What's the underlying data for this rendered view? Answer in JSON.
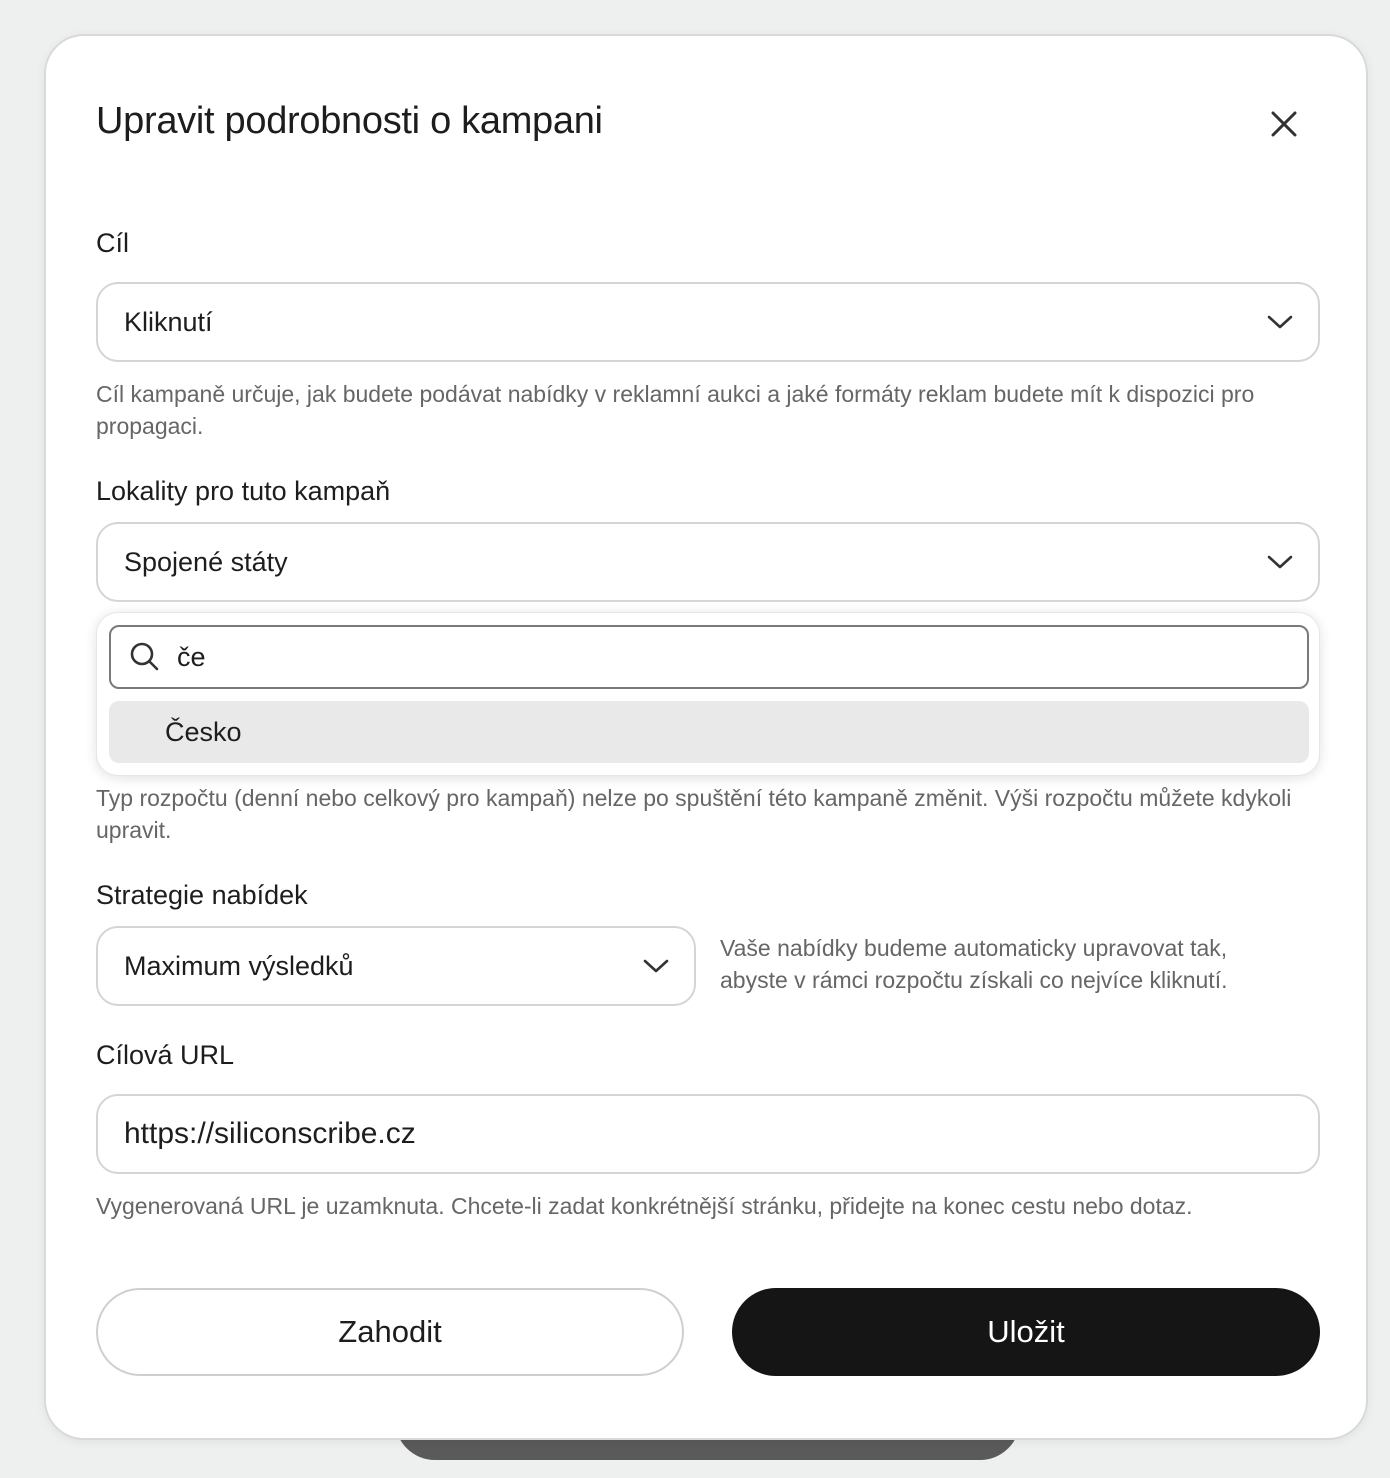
{
  "dialog": {
    "title": "Upravit podrobnosti o kampani",
    "close_icon": "close-icon"
  },
  "goal": {
    "label": "Cíl",
    "value": "Kliknutí",
    "help": "Cíl kampaně určuje, jak budete podávat nabídky v reklamní aukci a jaké formáty reklam budete mít k dispozici pro propagaci."
  },
  "locations": {
    "label": "Lokality pro tuto kampaň",
    "value": "Spojené státy",
    "search_value": "če",
    "options": [
      "Česko"
    ]
  },
  "budget": {
    "help": "Typ rozpočtu (denní nebo celkový pro kampaň) nelze po spuštění této kampaně změnit. Výši rozpočtu můžete kdykoli upravit."
  },
  "bidding": {
    "label": "Strategie nabídek",
    "value": "Maximum výsledků",
    "note": "Vaše nabídky budeme automaticky upravovat tak, abyste v rámci rozpočtu získali co nejvíce kliknutí."
  },
  "destination": {
    "label": "Cílová URL",
    "value": "https://siliconscribe.cz",
    "help": "Vygenerovaná URL je uzamknuta. Chcete-li zadat konkrétnější stránku, přidejte na konec cestu nebo dotaz."
  },
  "actions": {
    "discard_label": "Zahodit",
    "save_label": "Uložit"
  },
  "colors": {
    "primary_button": "#151515",
    "option_highlight": "#e9e9e9"
  }
}
